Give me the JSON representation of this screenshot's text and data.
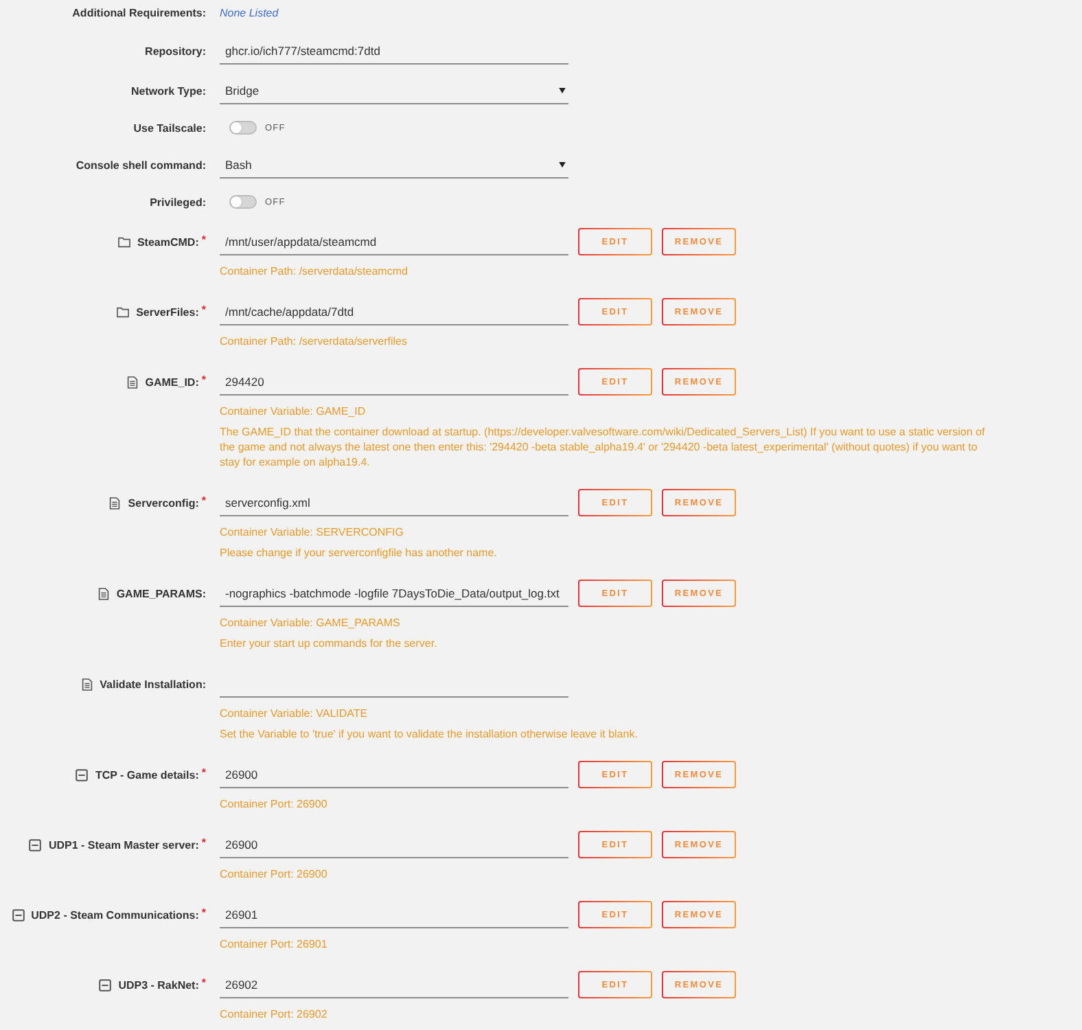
{
  "settings": [
    {
      "kind": "info",
      "label": "Additional Requirements:",
      "value": "None Listed"
    },
    {
      "kind": "text",
      "label": "Repository:",
      "value": "ghcr.io/ich777/steamcmd:7dtd"
    },
    {
      "kind": "select",
      "label": "Network Type:",
      "value": "Bridge"
    },
    {
      "kind": "toggle",
      "label": "Use Tailscale:",
      "on": false,
      "state_label": "OFF"
    },
    {
      "kind": "select",
      "label": "Console shell command:",
      "value": "Bash"
    },
    {
      "kind": "toggle",
      "label": "Privileged:",
      "on": false,
      "state_label": "OFF"
    }
  ],
  "config_items": [
    {
      "kind": "path",
      "label": "SteamCMD:",
      "required_mark": "*",
      "value": "/mnt/user/appdata/steamcmd",
      "buttons": [
        "EDIT",
        "REMOVE"
      ],
      "descriptions": [
        "Container Path: /serverdata/steamcmd"
      ]
    },
    {
      "kind": "path",
      "label": "ServerFiles:",
      "required_mark": "*",
      "value": "/mnt/cache/appdata/7dtd",
      "buttons": [
        "EDIT",
        "REMOVE"
      ],
      "descriptions": [
        "Container Path: /serverdata/serverfiles"
      ]
    },
    {
      "kind": "variable",
      "label": "GAME_ID:",
      "required_mark": "*",
      "value": "294420",
      "buttons": [
        "EDIT",
        "REMOVE"
      ],
      "descriptions": [
        "Container Variable: GAME_ID",
        "The GAME_ID that the container download at startup. (https://developer.valvesoftware.com/wiki/Dedicated_Servers_List) If you want to use a static version of the game and not always the latest one then enter this: '294420 -beta stable_alpha19.4' or '294420 -beta latest_experimental' (without quotes) if you want to stay for example on alpha19.4."
      ]
    },
    {
      "kind": "variable",
      "label": "Serverconfig:",
      "required_mark": "*",
      "value": "serverconfig.xml",
      "buttons": [
        "EDIT",
        "REMOVE"
      ],
      "descriptions": [
        "Container Variable: SERVERCONFIG",
        "Please change if your serverconfigfile has another name."
      ]
    },
    {
      "kind": "variable",
      "label": "GAME_PARAMS:",
      "value": "-nographics -batchmode -logfile 7DaysToDie_Data/output_log.txt",
      "buttons": [
        "EDIT",
        "REMOVE"
      ],
      "descriptions": [
        "Container Variable: GAME_PARAMS",
        "Enter your start up commands for the server."
      ]
    },
    {
      "kind": "variable",
      "label": "Validate Installation:",
      "descriptions": [
        "Container Variable: VALIDATE",
        "Set the Variable to 'true' if you want to validate the installation otherwise leave it blank."
      ]
    },
    {
      "kind": "port",
      "label": "TCP - Game details:",
      "required_mark": "*",
      "value": "26900",
      "buttons": [
        "EDIT",
        "REMOVE"
      ],
      "descriptions": [
        "Container Port: 26900"
      ]
    },
    {
      "kind": "port",
      "label": "UDP1 - Steam Master server:",
      "required_mark": "*",
      "value": "26900",
      "buttons": [
        "EDIT",
        "REMOVE"
      ],
      "descriptions": [
        "Container Port: 26900"
      ]
    },
    {
      "kind": "port",
      "label": "UDP2 - Steam Communications:",
      "required_mark": "*",
      "value": "26901",
      "buttons": [
        "EDIT",
        "REMOVE"
      ],
      "descriptions": [
        "Container Port: 26901"
      ]
    },
    {
      "kind": "port",
      "label": "UDP3 - RakNet:",
      "required_mark": "*",
      "value": "26902",
      "buttons": [
        "EDIT",
        "REMOVE"
      ],
      "descriptions": [
        "Container Port: 26902"
      ]
    }
  ]
}
